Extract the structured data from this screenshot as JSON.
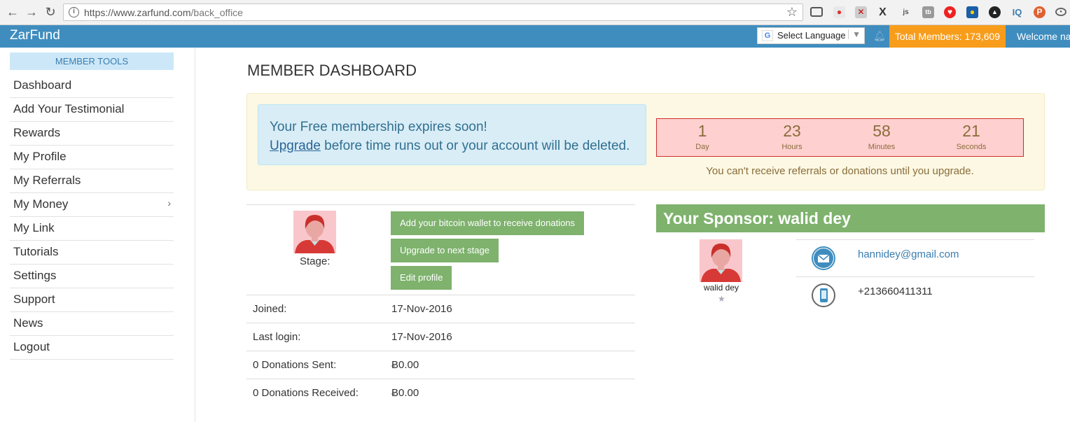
{
  "browser": {
    "url_prefix": "https://www.zarfund.com",
    "url_path": "/back_office"
  },
  "header": {
    "brand": "ZarFund",
    "language_label": "Select Language",
    "total_members": "Total Members: 173,609",
    "welcome": "Welcome na"
  },
  "sidebar": {
    "section_title": "MEMBER TOOLS",
    "items": [
      {
        "label": "Dashboard"
      },
      {
        "label": "Add Your Testimonial"
      },
      {
        "label": "Rewards"
      },
      {
        "label": "My Profile"
      },
      {
        "label": "My Referrals"
      },
      {
        "label": "My Money"
      },
      {
        "label": "My Link"
      },
      {
        "label": "Tutorials"
      },
      {
        "label": "Settings"
      },
      {
        "label": "Support"
      },
      {
        "label": "News"
      },
      {
        "label": "Logout"
      }
    ]
  },
  "main": {
    "title": "MEMBER DASHBOARD",
    "alert": {
      "line1": "Your Free membership expires soon!",
      "link": "Upgrade",
      "line2_rest": " before time runs out or your account will be deleted."
    },
    "countdown": {
      "days": "1",
      "days_label": "Day",
      "hours": "23",
      "hours_label": "Hours",
      "minutes": "58",
      "minutes_label": "Minutes",
      "seconds": "21",
      "seconds_label": "Seconds",
      "note": "You can't receive referrals or donations until you upgrade."
    },
    "profile": {
      "stage_label": "Stage:",
      "btn_wallet": "Add your bitcoin wallet to receive donations",
      "btn_upgrade": "Upgrade to next stage",
      "btn_edit": "Edit profile",
      "rows": [
        {
          "key": "Joined:",
          "value": "17-Nov-2016"
        },
        {
          "key": "Last login:",
          "value": "17-Nov-2016"
        },
        {
          "key": "0 Donations Sent:",
          "value": "Ƀ0.00"
        },
        {
          "key": "0 Donations Received:",
          "value": "Ƀ0.00"
        }
      ]
    },
    "sponsor": {
      "title": "Your Sponsor: walid dey",
      "name": "walid dey",
      "email": "hannidey@gmail.com",
      "phone": "+213660411311"
    }
  },
  "colors": {
    "topbar": "#3f8dbf",
    "accent_orange": "#f89d1b",
    "green": "#7eb26d",
    "alert_bg": "#fcf8e3"
  }
}
